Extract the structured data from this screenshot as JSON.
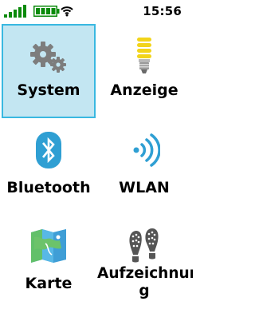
{
  "status_bar": {
    "time": "15:56",
    "signal_icon": "signal-bars-icon",
    "battery_icon": "battery-icon",
    "wifi_icon": "wifi-icon",
    "accent_color": "#0b8a0b"
  },
  "menu": {
    "selected_tile": "System",
    "colors": {
      "selected_background": "#c3e6f2",
      "selected_border": "#39b8e1"
    },
    "tiles": [
      {
        "label": "System",
        "icon": "gears-icon"
      },
      {
        "label": "Anzeige",
        "icon": "lightbulb-icon"
      },
      {
        "label": "Bluetooth",
        "icon": "bluetooth-icon"
      },
      {
        "label": "WLAN",
        "icon": "wlan-icon"
      },
      {
        "label": "Karte",
        "icon": "map-icon"
      },
      {
        "label_line1": "Aufzeichnun-",
        "label_line2": "g",
        "icon": "footprints-icon"
      }
    ]
  }
}
